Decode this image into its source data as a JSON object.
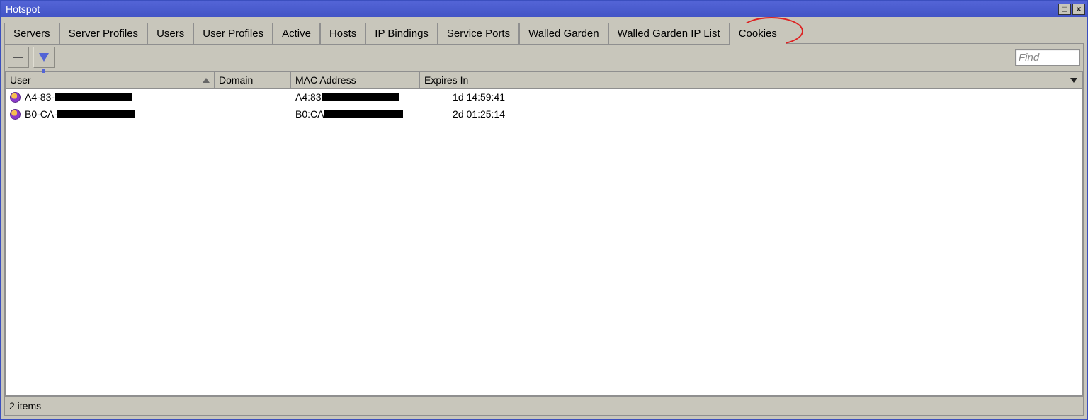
{
  "window": {
    "title": "Hotspot"
  },
  "tabs": [
    {
      "label": "Servers"
    },
    {
      "label": "Server Profiles"
    },
    {
      "label": "Users"
    },
    {
      "label": "User Profiles"
    },
    {
      "label": "Active"
    },
    {
      "label": "Hosts"
    },
    {
      "label": "IP Bindings"
    },
    {
      "label": "Service Ports"
    },
    {
      "label": "Walled Garden"
    },
    {
      "label": "Walled Garden IP List"
    },
    {
      "label": "Cookies"
    }
  ],
  "active_tab_index": 10,
  "toolbar": {
    "find_placeholder": "Find"
  },
  "columns": {
    "user": "User",
    "domain": "Domain",
    "mac": "MAC Address",
    "expires": "Expires In"
  },
  "rows": [
    {
      "user_prefix": "A4-83-",
      "domain": "",
      "mac_prefix": "A4:83",
      "expires": "1d 14:59:41"
    },
    {
      "user_prefix": "B0-CA-",
      "domain": "",
      "mac_prefix": "B0:CA",
      "expires": "2d 01:25:14"
    }
  ],
  "status": "2 items"
}
